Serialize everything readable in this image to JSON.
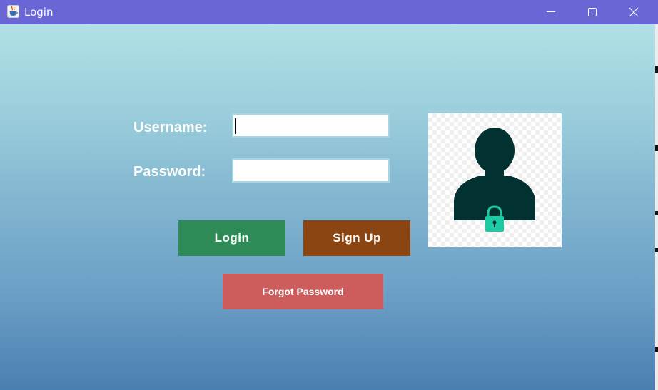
{
  "window": {
    "title": "Login",
    "app_icon": "java-cup-icon",
    "controls": [
      "minimize-icon",
      "maximize-icon",
      "close-icon"
    ]
  },
  "form": {
    "username_label": "Username:",
    "username_value": "",
    "password_label": "Password:",
    "password_value": ""
  },
  "buttons": {
    "login": "Login",
    "signup": "Sign Up",
    "forgot": "Forgot Password"
  },
  "image": {
    "icon": "user-lock-icon"
  },
  "colors": {
    "titlebar": "#6a66d6",
    "login_button": "#2e8b57",
    "signup_button": "#8b4513",
    "forgot_button": "#cd5c5c",
    "gradient_top": "#b1e1e6",
    "gradient_bottom": "#4a7fb1",
    "avatar_silhouette": "#013130",
    "lock": "#1cc9a3"
  }
}
